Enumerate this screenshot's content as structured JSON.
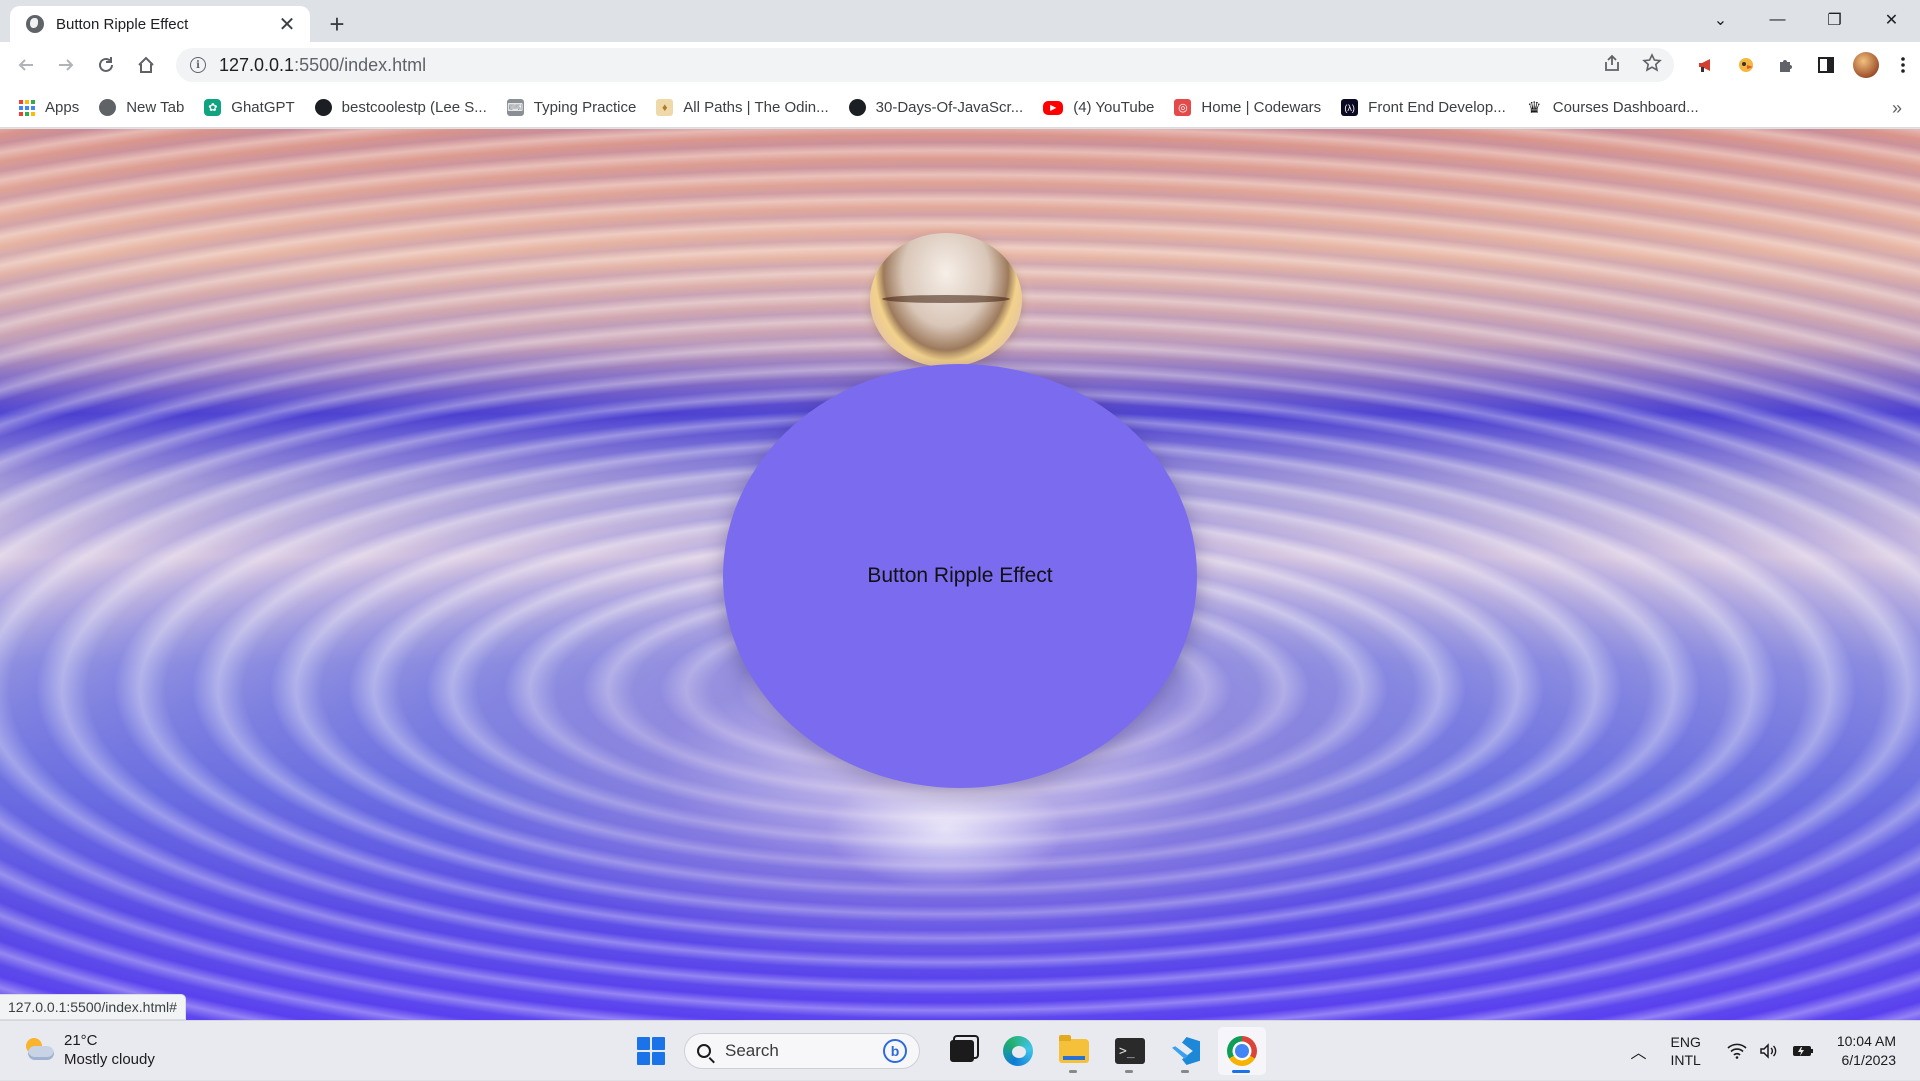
{
  "browser": {
    "tab": {
      "title": "Button Ripple Effect",
      "close_glyph": "✕"
    },
    "new_tab_glyph": "+",
    "window_controls": {
      "tab_search": "⌄",
      "minimize": "—",
      "restore": "❐",
      "close": "✕"
    },
    "address_bar": {
      "host": "127.0.0.1",
      "path": ":5500/index.html"
    },
    "bookmarks": [
      {
        "label": "Apps",
        "icon": "apps-grid-icon"
      },
      {
        "label": "New Tab",
        "icon": "globe-icon"
      },
      {
        "label": "GhatGPT",
        "icon": "chatgpt-icon"
      },
      {
        "label": "bestcoolestp (Lee S...",
        "icon": "github-icon"
      },
      {
        "label": "Typing Practice",
        "icon": "typing-icon"
      },
      {
        "label": "All Paths | The Odin...",
        "icon": "odin-icon"
      },
      {
        "label": "30-Days-Of-JavaScr...",
        "icon": "github-icon"
      },
      {
        "label": "(4) YouTube",
        "icon": "youtube-icon"
      },
      {
        "label": "Home | Codewars",
        "icon": "codewars-icon"
      },
      {
        "label": "Front End Develop...",
        "icon": "freecodecamp-icon"
      },
      {
        "label": "Courses Dashboard...",
        "icon": "crown-icon"
      }
    ],
    "bookmarks_more": "»",
    "status_url": "127.0.0.1:5500/index.html#"
  },
  "page": {
    "button_label": "Button Ripple Effect",
    "button_color": "#7b6bef"
  },
  "taskbar": {
    "weather": {
      "temp": "21°C",
      "condition": "Mostly cloudy"
    },
    "search_label": "Search",
    "language": {
      "line1": "ENG",
      "line2": "INTL"
    },
    "clock": {
      "time": "10:04 AM",
      "date": "6/1/2023"
    }
  }
}
